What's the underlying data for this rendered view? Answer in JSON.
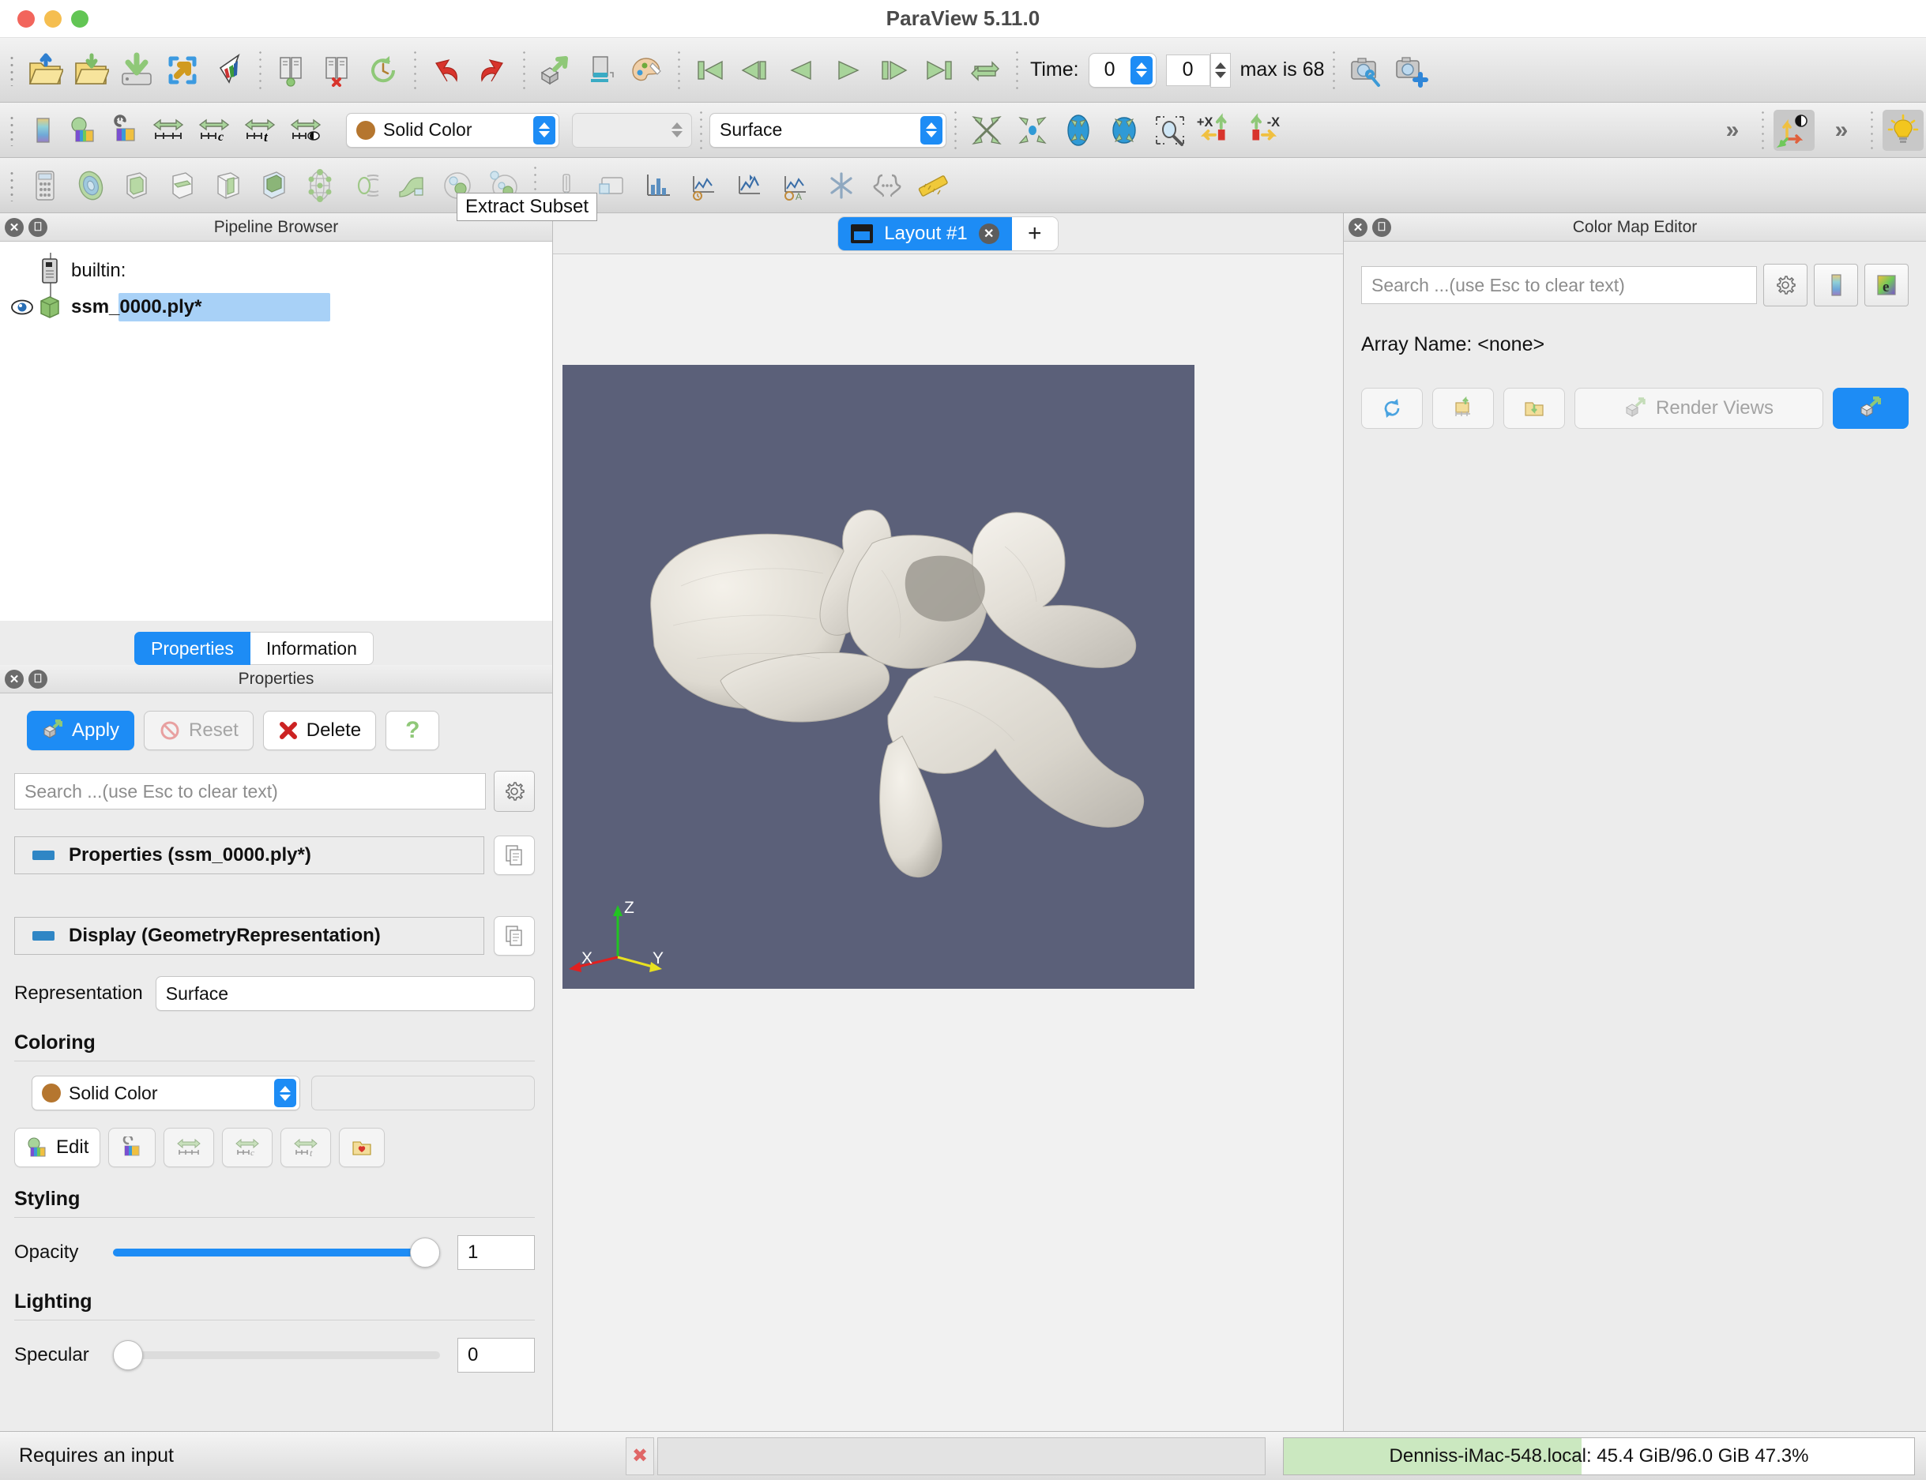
{
  "window": {
    "title": "ParaView 5.11.0",
    "traffic_lights": [
      "close",
      "minimize",
      "maximize"
    ]
  },
  "toolbar_main": {
    "items": [
      {
        "name": "open-file-icon"
      },
      {
        "name": "recent-files-icon"
      },
      {
        "name": "save-data-icon"
      },
      {
        "name": "load-state-icon"
      },
      {
        "name": "save-screenshot-icon"
      },
      {
        "name": "connect-server-icon"
      },
      {
        "name": "disconnect-server-icon"
      },
      {
        "name": "reset-session-icon"
      },
      {
        "name": "undo-icon"
      },
      {
        "name": "redo-icon"
      },
      {
        "name": "camera-undo-icon"
      },
      {
        "name": "interactive-select-icon"
      },
      {
        "name": "color-palette-icon"
      }
    ],
    "vcr": [
      {
        "name": "first-frame-icon"
      },
      {
        "name": "previous-frame-icon"
      },
      {
        "name": "play-reverse-icon"
      },
      {
        "name": "play-icon"
      },
      {
        "name": "next-frame-icon"
      },
      {
        "name": "last-frame-icon"
      },
      {
        "name": "loop-icon"
      }
    ],
    "time": {
      "label": "Time:",
      "value": "0",
      "frame_index": "0",
      "max_text": "max is 68"
    },
    "camera_buttons": [
      {
        "name": "adjust-camera-icon"
      },
      {
        "name": "add-camera-icon"
      }
    ]
  },
  "toolbar_display": {
    "left_icons": [
      {
        "name": "toggle-color-legend-icon"
      },
      {
        "name": "edit-color-map-icon"
      },
      {
        "name": "reset-color-map-icon"
      },
      {
        "name": "rescale-to-data-range-icon"
      },
      {
        "name": "rescale-custom-range-icon"
      },
      {
        "name": "rescale-over-time-icon"
      },
      {
        "name": "rescale-visible-range-icon"
      }
    ],
    "coloring_combo": {
      "value": "Solid Color",
      "swatch": "#b5762f"
    },
    "component_combo": {
      "value": ""
    },
    "representation_combo": {
      "value": "Surface"
    },
    "right_icons": [
      {
        "name": "reset-camera-icon"
      },
      {
        "name": "zoom-closest-icon"
      },
      {
        "name": "rotate-camera-icon"
      },
      {
        "name": "zoom-to-box-icon"
      },
      {
        "name": "selection-zoom-icon"
      },
      {
        "name": "set-view-plus-x-icon"
      },
      {
        "name": "set-view-minus-x-icon"
      },
      {
        "name": "more-options-icon"
      },
      {
        "name": "show-orientation-axes-icon"
      },
      {
        "name": "more-options-2-icon"
      },
      {
        "name": "edit-light-icon"
      }
    ]
  },
  "toolbar_filters": {
    "items": [
      {
        "name": "calculator-icon"
      },
      {
        "name": "contour-icon"
      },
      {
        "name": "clip-icon"
      },
      {
        "name": "slice-icon"
      },
      {
        "name": "threshold-icon"
      },
      {
        "name": "extract-subset-icon"
      },
      {
        "name": "glyph-icon"
      },
      {
        "name": "stream-tracer-icon"
      },
      {
        "name": "warp-by-vector-icon"
      },
      {
        "name": "group-datasets-icon"
      },
      {
        "name": "extract-level-icon"
      },
      {
        "name": "plot-over-line-icon"
      },
      {
        "name": "plot-data-icon"
      },
      {
        "name": "histogram-icon"
      },
      {
        "name": "plot-selection-over-time-icon"
      },
      {
        "name": "plot-data-over-time-icon"
      },
      {
        "name": "temporal-statistics-icon"
      },
      {
        "name": "python-calculator-icon"
      },
      {
        "name": "programmable-filter-icon"
      },
      {
        "name": "ruler-icon"
      }
    ],
    "tooltip": "Extract Subset"
  },
  "pipeline_browser": {
    "title": "Pipeline Browser",
    "items": [
      {
        "label": "builtin:",
        "icon": "server-icon",
        "selected": false,
        "eye": false
      },
      {
        "label": "ssm_0000.ply*",
        "icon": "geometry-icon",
        "selected": true,
        "eye": true
      }
    ]
  },
  "properties_panel": {
    "tabs": [
      {
        "label": "Properties",
        "active": true
      },
      {
        "label": "Information",
        "active": false
      }
    ],
    "title": "Properties",
    "buttons": [
      {
        "label": "Apply",
        "name": "apply-button",
        "state": "primary"
      },
      {
        "label": "Reset",
        "name": "reset-button",
        "state": "disabled"
      },
      {
        "label": "Delete",
        "name": "delete-button",
        "state": "normal"
      },
      {
        "label": "?",
        "name": "help-button",
        "state": "normal"
      }
    ],
    "search_placeholder": "Search ...(use Esc to clear text)",
    "sections": [
      {
        "label": "Properties (ssm_0000.ply*)"
      },
      {
        "label": "Display (GeometryRepresentation)"
      }
    ],
    "representation": {
      "label": "Representation",
      "value": "Surface"
    },
    "coloring": {
      "heading": "Coloring",
      "value": "Solid Color",
      "swatch": "#b5762f",
      "edit_label": "Edit",
      "icons": [
        {
          "name": "edit-color-legend-icon"
        },
        {
          "name": "reset-range-icon"
        },
        {
          "name": "rescale-data-range-icon"
        },
        {
          "name": "rescale-custom-icon"
        },
        {
          "name": "rescale-time-icon"
        },
        {
          "name": "choose-preset-icon"
        }
      ]
    },
    "styling": {
      "heading": "Styling",
      "opacity": {
        "label": "Opacity",
        "value": "1",
        "percent": 100
      }
    },
    "lighting": {
      "heading": "Lighting",
      "specular": {
        "label": "Specular",
        "value": "0",
        "percent": 0
      }
    }
  },
  "layout": {
    "tab_label": "Layout #1",
    "add_label": "+"
  },
  "render_view": {
    "background": "#5b6079",
    "mesh_description": "vertebra-bone-surface-mesh",
    "axes": [
      {
        "label": "X",
        "color": "#e02020"
      },
      {
        "label": "Y",
        "color": "#e8e020"
      },
      {
        "label": "Z",
        "color": "#22c422"
      }
    ]
  },
  "color_map_editor": {
    "title": "Color Map Editor",
    "search_placeholder": "Search ...(use Esc to clear text)",
    "header_icons": [
      {
        "name": "gear-icon"
      },
      {
        "name": "color-legend-icon"
      },
      {
        "name": "edit-color-icon"
      }
    ],
    "array_name": "Array Name: <none>",
    "buttons": [
      {
        "label": "",
        "name": "rescale-restore-button"
      },
      {
        "label": "",
        "name": "save-preset-button"
      },
      {
        "label": "",
        "name": "load-preset-button"
      },
      {
        "label": "Render Views",
        "name": "render-views-button"
      },
      {
        "label": "",
        "name": "apply-colormap-button"
      }
    ]
  },
  "status_bar": {
    "message": "Requires an input",
    "memory": "Denniss-iMac-548.local: 45.4 GiB/96.0 GiB 47.3%",
    "memory_percent": 47.3
  }
}
